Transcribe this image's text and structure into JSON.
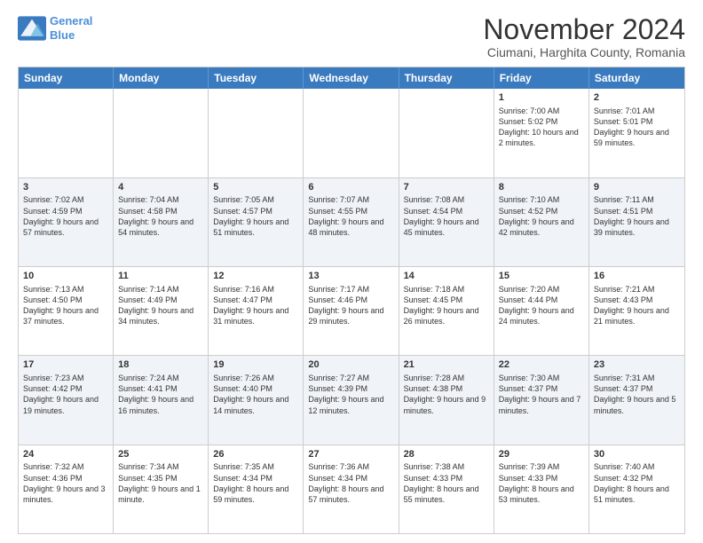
{
  "header": {
    "logo": {
      "line1": "General",
      "line2": "Blue"
    },
    "title": "November 2024",
    "subtitle": "Ciumani, Harghita County, Romania"
  },
  "days": [
    "Sunday",
    "Monday",
    "Tuesday",
    "Wednesday",
    "Thursday",
    "Friday",
    "Saturday"
  ],
  "rows": [
    [
      {
        "day": "",
        "content": ""
      },
      {
        "day": "",
        "content": ""
      },
      {
        "day": "",
        "content": ""
      },
      {
        "day": "",
        "content": ""
      },
      {
        "day": "",
        "content": ""
      },
      {
        "day": "1",
        "content": "Sunrise: 7:00 AM\nSunset: 5:02 PM\nDaylight: 10 hours and 2 minutes."
      },
      {
        "day": "2",
        "content": "Sunrise: 7:01 AM\nSunset: 5:01 PM\nDaylight: 9 hours and 59 minutes."
      }
    ],
    [
      {
        "day": "3",
        "content": "Sunrise: 7:02 AM\nSunset: 4:59 PM\nDaylight: 9 hours and 57 minutes."
      },
      {
        "day": "4",
        "content": "Sunrise: 7:04 AM\nSunset: 4:58 PM\nDaylight: 9 hours and 54 minutes."
      },
      {
        "day": "5",
        "content": "Sunrise: 7:05 AM\nSunset: 4:57 PM\nDaylight: 9 hours and 51 minutes."
      },
      {
        "day": "6",
        "content": "Sunrise: 7:07 AM\nSunset: 4:55 PM\nDaylight: 9 hours and 48 minutes."
      },
      {
        "day": "7",
        "content": "Sunrise: 7:08 AM\nSunset: 4:54 PM\nDaylight: 9 hours and 45 minutes."
      },
      {
        "day": "8",
        "content": "Sunrise: 7:10 AM\nSunset: 4:52 PM\nDaylight: 9 hours and 42 minutes."
      },
      {
        "day": "9",
        "content": "Sunrise: 7:11 AM\nSunset: 4:51 PM\nDaylight: 9 hours and 39 minutes."
      }
    ],
    [
      {
        "day": "10",
        "content": "Sunrise: 7:13 AM\nSunset: 4:50 PM\nDaylight: 9 hours and 37 minutes."
      },
      {
        "day": "11",
        "content": "Sunrise: 7:14 AM\nSunset: 4:49 PM\nDaylight: 9 hours and 34 minutes."
      },
      {
        "day": "12",
        "content": "Sunrise: 7:16 AM\nSunset: 4:47 PM\nDaylight: 9 hours and 31 minutes."
      },
      {
        "day": "13",
        "content": "Sunrise: 7:17 AM\nSunset: 4:46 PM\nDaylight: 9 hours and 29 minutes."
      },
      {
        "day": "14",
        "content": "Sunrise: 7:18 AM\nSunset: 4:45 PM\nDaylight: 9 hours and 26 minutes."
      },
      {
        "day": "15",
        "content": "Sunrise: 7:20 AM\nSunset: 4:44 PM\nDaylight: 9 hours and 24 minutes."
      },
      {
        "day": "16",
        "content": "Sunrise: 7:21 AM\nSunset: 4:43 PM\nDaylight: 9 hours and 21 minutes."
      }
    ],
    [
      {
        "day": "17",
        "content": "Sunrise: 7:23 AM\nSunset: 4:42 PM\nDaylight: 9 hours and 19 minutes."
      },
      {
        "day": "18",
        "content": "Sunrise: 7:24 AM\nSunset: 4:41 PM\nDaylight: 9 hours and 16 minutes."
      },
      {
        "day": "19",
        "content": "Sunrise: 7:26 AM\nSunset: 4:40 PM\nDaylight: 9 hours and 14 minutes."
      },
      {
        "day": "20",
        "content": "Sunrise: 7:27 AM\nSunset: 4:39 PM\nDaylight: 9 hours and 12 minutes."
      },
      {
        "day": "21",
        "content": "Sunrise: 7:28 AM\nSunset: 4:38 PM\nDaylight: 9 hours and 9 minutes."
      },
      {
        "day": "22",
        "content": "Sunrise: 7:30 AM\nSunset: 4:37 PM\nDaylight: 9 hours and 7 minutes."
      },
      {
        "day": "23",
        "content": "Sunrise: 7:31 AM\nSunset: 4:37 PM\nDaylight: 9 hours and 5 minutes."
      }
    ],
    [
      {
        "day": "24",
        "content": "Sunrise: 7:32 AM\nSunset: 4:36 PM\nDaylight: 9 hours and 3 minutes."
      },
      {
        "day": "25",
        "content": "Sunrise: 7:34 AM\nSunset: 4:35 PM\nDaylight: 9 hours and 1 minute."
      },
      {
        "day": "26",
        "content": "Sunrise: 7:35 AM\nSunset: 4:34 PM\nDaylight: 8 hours and 59 minutes."
      },
      {
        "day": "27",
        "content": "Sunrise: 7:36 AM\nSunset: 4:34 PM\nDaylight: 8 hours and 57 minutes."
      },
      {
        "day": "28",
        "content": "Sunrise: 7:38 AM\nSunset: 4:33 PM\nDaylight: 8 hours and 55 minutes."
      },
      {
        "day": "29",
        "content": "Sunrise: 7:39 AM\nSunset: 4:33 PM\nDaylight: 8 hours and 53 minutes."
      },
      {
        "day": "30",
        "content": "Sunrise: 7:40 AM\nSunset: 4:32 PM\nDaylight: 8 hours and 51 minutes."
      }
    ]
  ]
}
